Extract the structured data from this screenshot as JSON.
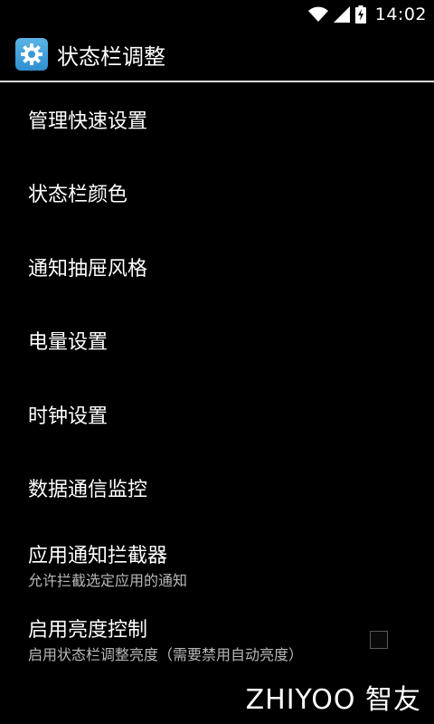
{
  "status_bar": {
    "time": "14:02",
    "icons": [
      "wifi-icon",
      "signal-icon",
      "battery-charging-icon"
    ]
  },
  "action_bar": {
    "app_icon": "settings-gear-icon",
    "title": "状态栏调整"
  },
  "settings": {
    "items": [
      {
        "label": "管理快速设置"
      },
      {
        "label": "状态栏颜色"
      },
      {
        "label": "通知抽屉风格"
      },
      {
        "label": "电量设置"
      },
      {
        "label": "时钟设置"
      },
      {
        "label": "数据通信监控"
      },
      {
        "label": "应用通知拦截器",
        "summary": "允许拦截选定应用的通知"
      },
      {
        "label": "启用亮度控制",
        "summary": "启用状态栏调整亮度（需要禁用自动亮度）",
        "checked": false
      }
    ]
  },
  "watermark": "ZHIYOO 智友",
  "colors": {
    "background": "#000000",
    "divider": "#d8d8d8",
    "summary_text": "#b8b8b8"
  }
}
